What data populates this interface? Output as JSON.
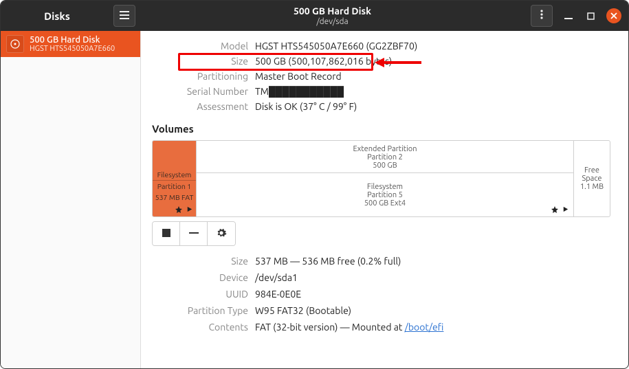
{
  "titlebar": {
    "app": "Disks",
    "title": "500 GB Hard Disk",
    "subtitle": "/dev/sda"
  },
  "sidebar": {
    "items": [
      {
        "title": "500 GB Hard Disk",
        "subtitle": "HGST HTS545050A7E660"
      }
    ]
  },
  "disk_info": {
    "model_label": "Model",
    "model": "HGST HTS545050A7E660 (GG2ZBF70)",
    "size_label": "Size",
    "size": "500 GB (500,107,862,016 bytes)",
    "partitioning_label": "Partitioning",
    "partitioning": "Master Boot Record",
    "serial_label": "Serial Number",
    "serial": "TM███████████",
    "assessment_label": "Assessment",
    "assessment": "Disk is OK (37° C / 99° F)"
  },
  "volumes": {
    "heading": "Volumes",
    "p1": {
      "l1": "Filesystem",
      "l2": "Partition 1",
      "l3": "537 MB FAT"
    },
    "ext": {
      "top_l1": "Extended Partition",
      "top_l2": "Partition 2",
      "top_l3": "500 GB",
      "bot_l1": "Filesystem",
      "bot_l2": "Partition 5",
      "bot_l3": "500 GB Ext4"
    },
    "free": {
      "l1": "Free Space",
      "l2": "1.1 MB"
    }
  },
  "partition_details": {
    "size_label": "Size",
    "size": "537 MB — 536 MB free (0.2% full)",
    "device_label": "Device",
    "device": "/dev/sda1",
    "uuid_label": "UUID",
    "uuid": "984E-0E0E",
    "ptype_label": "Partition Type",
    "ptype": "W95 FAT32 (Bootable)",
    "contents_label": "Contents",
    "contents_prefix": "FAT (32-bit version) — Mounted at ",
    "contents_link": "/boot/efi"
  }
}
